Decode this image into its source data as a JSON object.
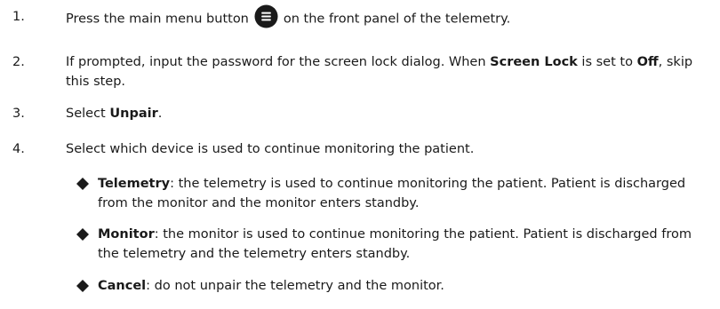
{
  "steps": [
    {
      "number": "1.",
      "text_before_icon": "Press the main menu button",
      "icon": "main-menu-icon",
      "text_after_icon": "on the front panel of the telemetry."
    },
    {
      "number": "2.",
      "parts": [
        "If prompted, input the password for the screen lock dialog. When ",
        "Screen Lock",
        " is set to ",
        "Off",
        ", skip this step."
      ]
    },
    {
      "number": "3.",
      "parts": [
        "Select ",
        "Unpair",
        "."
      ]
    },
    {
      "number": "4.",
      "text": "Select which device is used to continue monitoring the patient."
    }
  ],
  "options": [
    {
      "label": "Telemetry",
      "description": ": the telemetry is used to continue monitoring the patient. Patient is discharged from the monitor and the monitor enters standby."
    },
    {
      "label": "Monitor",
      "description": ": the monitor is used to continue monitoring the patient. Patient is discharged from the telemetry and the telemetry enters standby."
    },
    {
      "label": "Cancel",
      "description": ": do not unpair the telemetry and the monitor."
    }
  ],
  "colors": {
    "text": "#1a1a1a",
    "icon_fill": "#1a1a1a",
    "icon_lines": "#ffffff",
    "bullet": "#1a1a1a"
  }
}
